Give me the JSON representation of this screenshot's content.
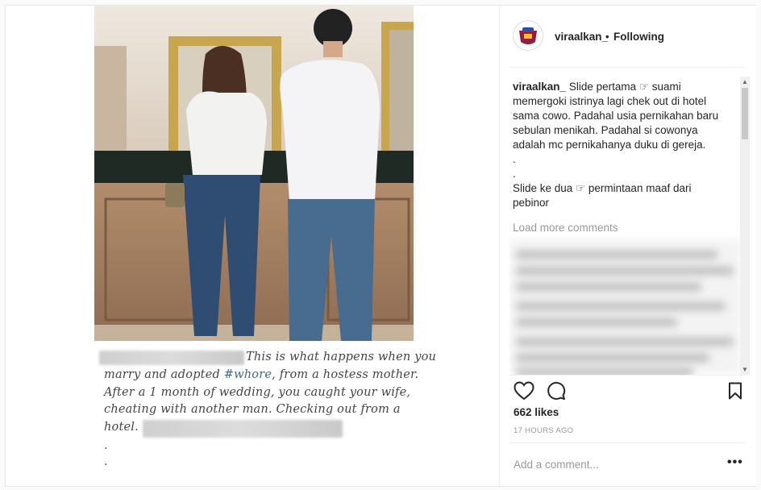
{
  "post": {
    "author": "viraalkan_",
    "separator": "•",
    "follow_state": "Following"
  },
  "image_caption": {
    "line1": "This is what happens when you",
    "line2_a": "marry and adopted ",
    "line2_hashtag": "#whore",
    "line2_b": ", from a hostess mother.",
    "line3": "After a 1 month of wedding, you caught your wife,",
    "line4": "cheating with another man. Checking out from a",
    "line5": "hotel.",
    "dot1": ".",
    "dot2": "."
  },
  "caption": {
    "username": "viraalkan_",
    "line1": "Slide pertama ☞ suami",
    "line2": "memergoki istrinya lagi chek out di hotel",
    "line3": "sama cowo. Padahal usia pernikahan baru",
    "line4": "sebulan menikah. Padahal si cowonya",
    "line5": "adalah mc pernikahanya duku di gereja.",
    "dot1": ".",
    "dot2": ".",
    "line6": "Slide ke dua ☞ permintaan maaf dari",
    "line7": "pebinor"
  },
  "load_more_label": "Load more comments",
  "likes": "662 likes",
  "timestamp": "17 HOURS AGO",
  "add_comment_placeholder": "Add a comment...",
  "more_label": "•••",
  "icons": {
    "like": "heart-icon",
    "comment": "comment-bubble-icon",
    "save": "bookmark-icon",
    "scroll_up": "scroll-up-arrow-icon",
    "scroll_down": "scroll-down-arrow-icon"
  },
  "colors": {
    "text": "#262626",
    "muted": "#999999",
    "border": "#efefef",
    "hashtag": "#3d6a8a"
  }
}
